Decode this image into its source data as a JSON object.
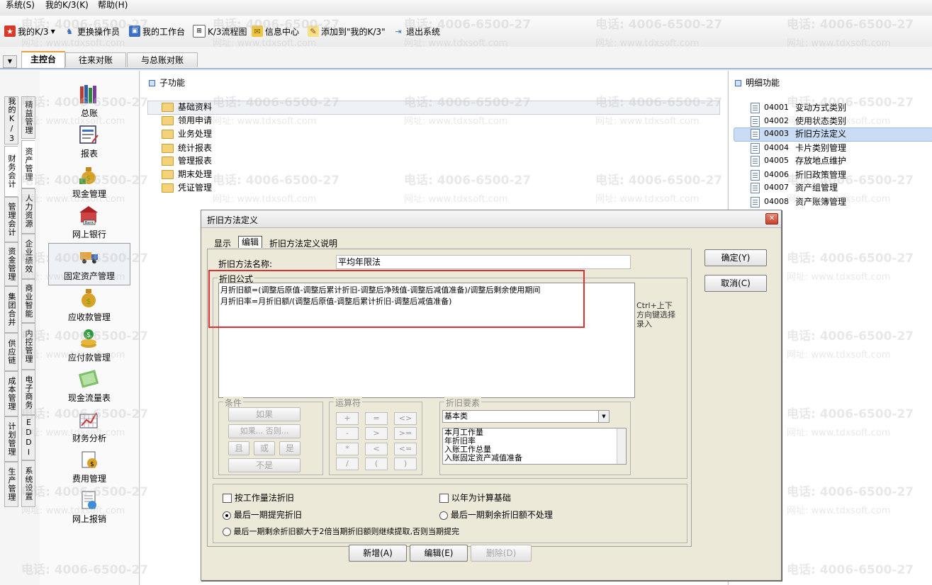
{
  "menu": {
    "items": [
      "系统(S)",
      "我的K/3(K)",
      "帮助(H)"
    ]
  },
  "toolbar": {
    "items": [
      {
        "label": "我的K/3",
        "icon": "star-icon"
      },
      {
        "label": "更换操作员",
        "icon": "user-switch-icon"
      },
      {
        "label": "我的工作台",
        "icon": "workbench-icon"
      },
      {
        "label": "K/3流程图",
        "icon": "flowchart-icon"
      },
      {
        "label": "信息中心",
        "icon": "message-icon"
      },
      {
        "label": "添加到\"我的K/3\"",
        "icon": "add-favorite-icon"
      },
      {
        "label": "退出系统",
        "icon": "exit-icon"
      }
    ]
  },
  "tabs": [
    "主控台",
    "往来对账",
    "与总账对账"
  ],
  "side_groups": {
    "col1": [
      "我的K/3",
      "财务会计",
      "管理会计",
      "资金管理",
      "集团合并",
      "供应链",
      "成本管理",
      "计划管理",
      "生产管理"
    ],
    "col2": [
      "精益管理",
      "资产管理",
      "人力资源",
      "企业绩效",
      "商业智能",
      "内控管理",
      "电子商务",
      "EDDI",
      "系统设置"
    ]
  },
  "modules": [
    "总账",
    "报表",
    "现金管理",
    "网上银行",
    "固定资产管理",
    "应收款管理",
    "应付款管理",
    "现金流量表",
    "财务分析",
    "费用管理",
    "网上报销"
  ],
  "subfunc": {
    "title": "子功能",
    "items": [
      "基础资料",
      "领用申请",
      "业务处理",
      "统计报表",
      "管理报表",
      "期末处理",
      "凭证管理"
    ]
  },
  "detail": {
    "title": "明细功能",
    "items": [
      {
        "code": "04001",
        "label": "变动方式类别"
      },
      {
        "code": "04002",
        "label": "使用状态类别"
      },
      {
        "code": "04003",
        "label": "折旧方法定义"
      },
      {
        "code": "04004",
        "label": "卡片类别管理"
      },
      {
        "code": "04005",
        "label": "存放地点维护"
      },
      {
        "code": "04006",
        "label": "折旧政策管理"
      },
      {
        "code": "04007",
        "label": "资产组管理"
      },
      {
        "code": "04008",
        "label": "资产账簿管理"
      }
    ]
  },
  "dialog": {
    "title": "折旧方法定义",
    "tabs": [
      "显示",
      "编辑",
      "折旧方法定义说明"
    ],
    "name_label": "折旧方法名称:",
    "name_value": "平均年限法",
    "formula_group": "折旧公式",
    "formula_line1": "月折旧额=(调整后原值-调整后累计折旧-调整后净残值-调整后减值准备)/调整后剩余使用期间",
    "formula_line2": "月折旧率=月折旧额/(调整后原值-调整后累计折旧-调整后减值准备)",
    "hint": "Ctrl+上下方向键选择录入",
    "ok": "确定(Y)",
    "cancel": "取消(C)",
    "cond_group": "条件",
    "cond_if": "如果",
    "cond_ifelse": "如果... 否则...",
    "cond_and": "且",
    "cond_or": "或",
    "cond_is": "是",
    "cond_not": "不是",
    "op_group": "运算符",
    "ops": [
      "+",
      "=",
      "<>",
      "-",
      ">",
      ">=",
      "*",
      "<",
      "<=",
      "/",
      "(",
      ")"
    ],
    "factor_group": "折旧要素",
    "factor_select": "基本类",
    "factors": [
      "本月工作量",
      "年折旧率",
      "入账工作总量",
      "入账固定资产减值准备"
    ],
    "opt_workload": "按工作量法折旧",
    "opt_year_base": "以年为计算基础",
    "opt_last_full": "最后一期提完折旧",
    "opt_last_skip": "最后一期剩余折旧额不处理",
    "opt_last_double": "最后一期剩余折旧额大于2倍当期折旧额则继续提取,否则当期提完",
    "btn_new": "新增(A)",
    "btn_edit": "编辑(E)",
    "btn_delete": "删除(D)"
  },
  "watermark": {
    "phone": "电话: 4006-6500-27",
    "url": "网址: www.tdxsoft.com"
  },
  "colors": {
    "highlight_box": "#e03030",
    "accent_tab": "#e9a23b",
    "selection": "#c9dcf3"
  }
}
